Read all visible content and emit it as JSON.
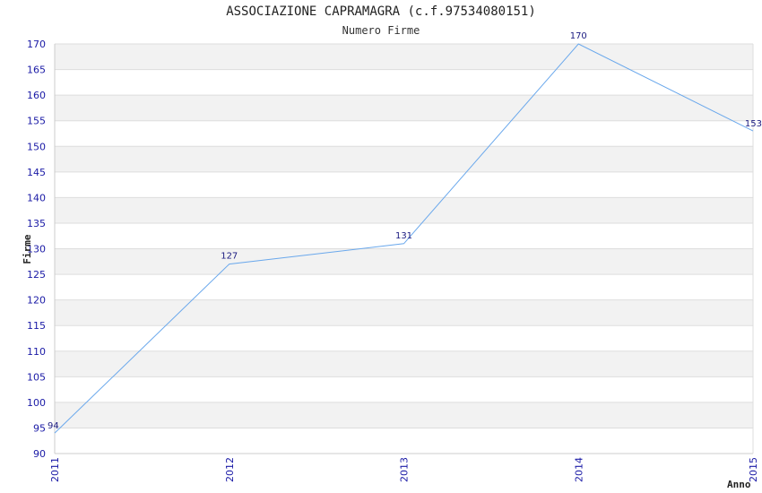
{
  "chart_data": {
    "type": "line",
    "title": "ASSOCIAZIONE CAPRAMAGRA (c.f.97534080151)",
    "subtitle": "Numero Firme",
    "xlabel": "Anno",
    "ylabel": "Firme",
    "x": [
      "2011",
      "2012",
      "2013",
      "2014",
      "2015"
    ],
    "series": [
      {
        "values": [
          94,
          127,
          131,
          170,
          153
        ]
      }
    ],
    "ylim": [
      90,
      170
    ],
    "ytick_step": 5,
    "grid": true,
    "colors": {
      "line": "#6aa8ec",
      "band": "#f2f2f2",
      "grid": "#dddddd",
      "tick_text": "#1a1aa6"
    }
  }
}
